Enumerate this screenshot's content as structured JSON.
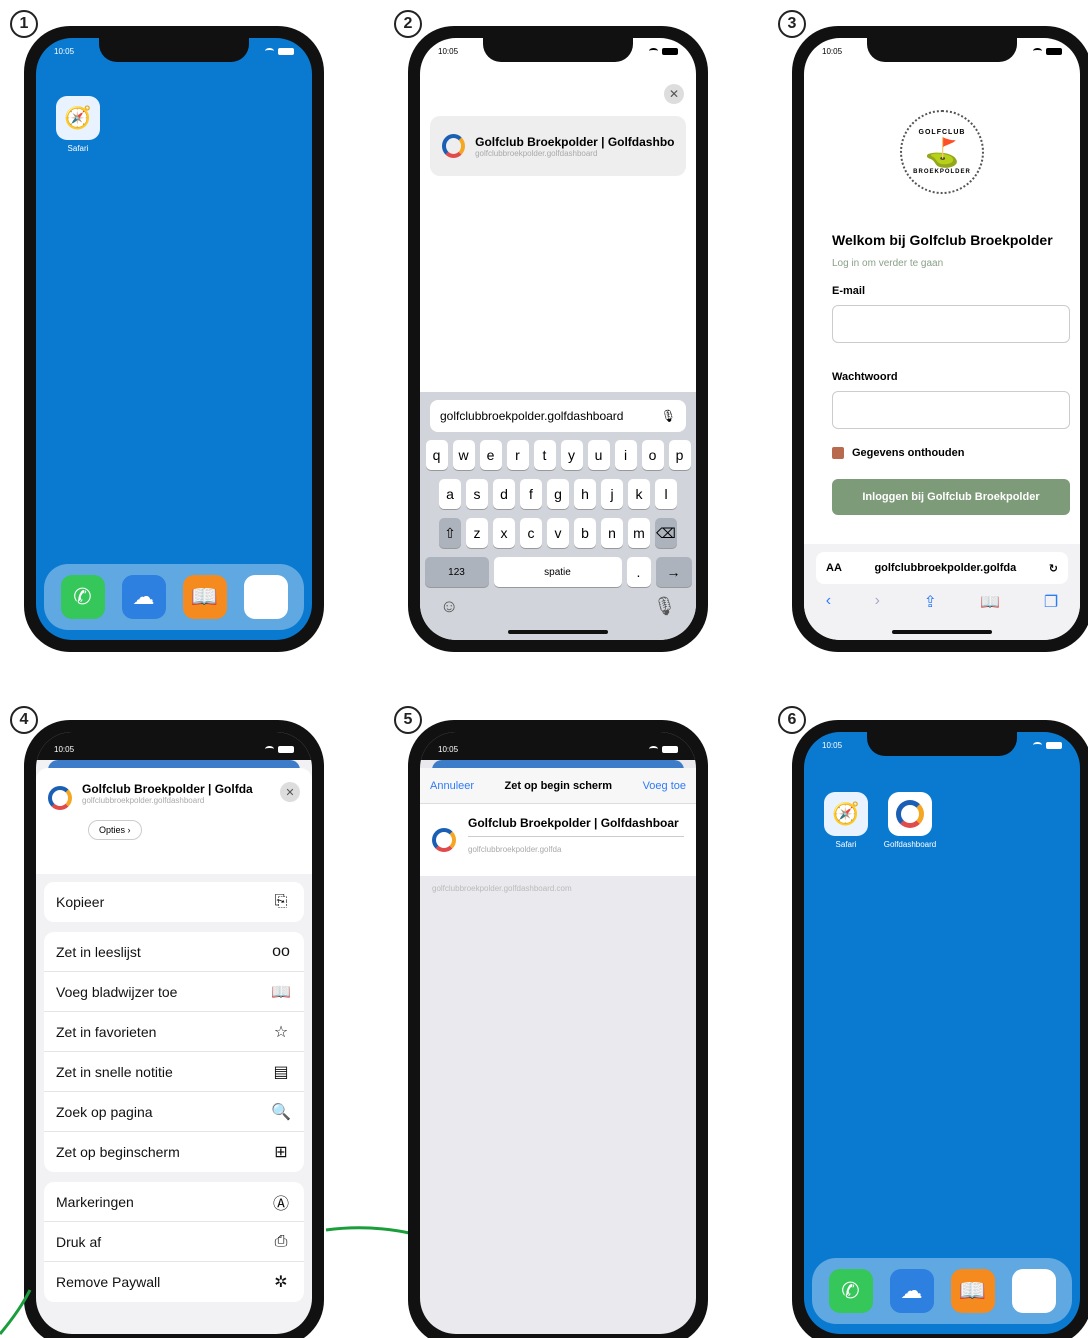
{
  "steps": [
    "1",
    "2",
    "3",
    "4",
    "5",
    "6"
  ],
  "status_time": "10:05",
  "phone1": {
    "safari_label": "Safari"
  },
  "phone2": {
    "suggest_title": "Golfclub Broekpolder | Golfdashboar",
    "suggest_url": "golfclubbroekpolder.golfdashboard",
    "address": "golfclubbroekpolder.golfdashboard",
    "row1": [
      "q",
      "w",
      "e",
      "r",
      "t",
      "y",
      "u",
      "i",
      "o",
      "p"
    ],
    "row2": [
      "a",
      "s",
      "d",
      "f",
      "g",
      "h",
      "j",
      "k",
      "l"
    ],
    "row3": [
      "z",
      "x",
      "c",
      "v",
      "b",
      "n",
      "m"
    ],
    "key_123": "123",
    "key_space": "spatie"
  },
  "phone3": {
    "logo_top": "GOLFCLUB",
    "logo_bottom": "BROEKPOLDER",
    "welcome": "Welkom bij Golfclub Broekpolder",
    "sub": "Log in om verder te gaan",
    "email_label": "E-mail",
    "password_label": "Wachtwoord",
    "remember": "Gegevens onthouden",
    "login_button": "Inloggen bij Golfclub Broekpolder",
    "url": "golfclubbroekpolder.golfda",
    "aa": "AA"
  },
  "phone4": {
    "title": "Golfclub Broekpolder | Golfda",
    "url": "golfclubbroekpolder.golfdashboard",
    "options": "Opties",
    "group1": [
      {
        "label": "Kopieer",
        "icon": "⎘"
      }
    ],
    "group2": [
      {
        "label": "Zet in leeslijst",
        "icon": "oo"
      },
      {
        "label": "Voeg bladwijzer toe",
        "icon": "📖"
      },
      {
        "label": "Zet in favorieten",
        "icon": "☆"
      },
      {
        "label": "Zet in snelle notitie",
        "icon": "▤"
      },
      {
        "label": "Zoek op pagina",
        "icon": "🔍"
      },
      {
        "label": "Zet op beginscherm",
        "icon": "⊞"
      }
    ],
    "group3": [
      {
        "label": "Markeringen",
        "icon": "Ⓐ"
      },
      {
        "label": "Druk af",
        "icon": "⎙"
      },
      {
        "label": "Remove Paywall",
        "icon": "✲"
      }
    ]
  },
  "phone5": {
    "cancel": "Annuleer",
    "title": "Zet op begin scherm",
    "add": "Voeg toe",
    "name": "Golfclub Broekpolder | Golfdashboar",
    "url_short": "golfclubbroekpolder.golfda",
    "url_full": "golfclubbroekpolder.golfdashboard.com"
  },
  "phone6": {
    "safari_label": "Safari",
    "golf_label": "Golfdashboard"
  },
  "colors": {
    "home_blue": "#0a7ad1",
    "green_button": "#7d9b78",
    "link_blue": "#2f7bf6"
  }
}
